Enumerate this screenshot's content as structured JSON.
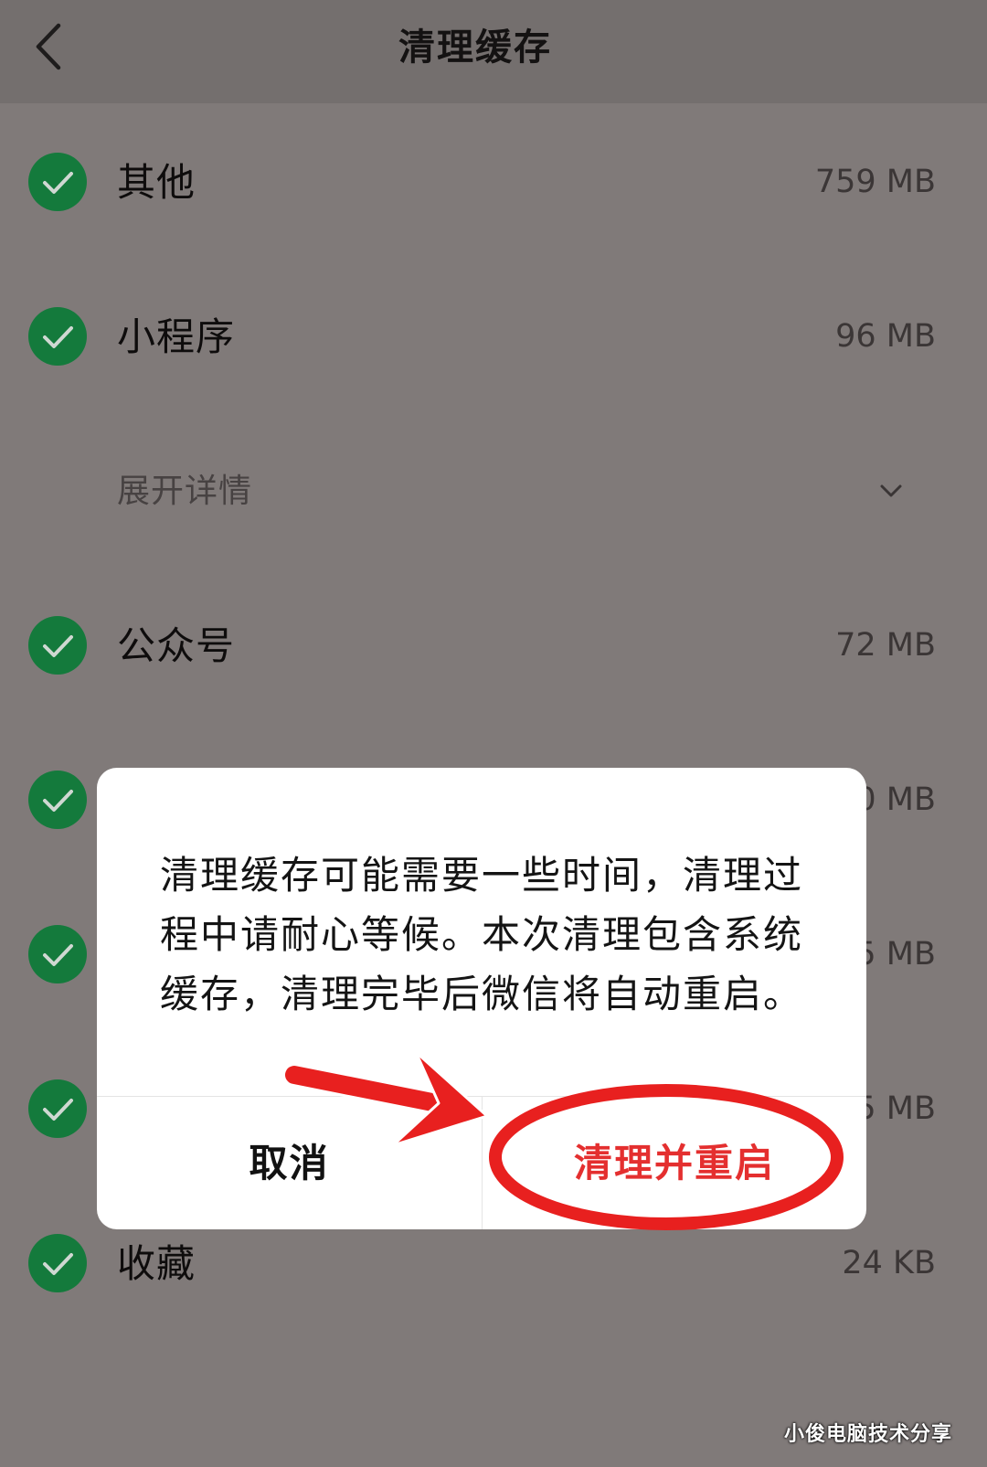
{
  "header": {
    "title": "清理缓存",
    "back_icon": "chevron-left-icon"
  },
  "items": [
    {
      "label": "其他",
      "size": "759 MB",
      "checked": true
    },
    {
      "label": "小程序",
      "size": "96 MB",
      "checked": true
    },
    {
      "label": "公众号",
      "size": "72 MB",
      "checked": true
    },
    {
      "size": "0 MB",
      "checked": true
    },
    {
      "size": "5 MB",
      "checked": true
    },
    {
      "size": "5 MB",
      "checked": true
    },
    {
      "label": "收藏",
      "size": "24 KB",
      "checked": true
    }
  ],
  "expand_details": {
    "label": "展开详情",
    "icon": "chevron-down-icon"
  },
  "dialog": {
    "message_lines": [
      "清理缓存可能需要一些时间，清理过",
      "程中请耐心等候。本次清理包含系统",
      "缓存，清理完毕后微信将自动重启。"
    ],
    "cancel_label": "取消",
    "confirm_label": "清理并重启"
  },
  "icons": {
    "check": "check-circle-icon"
  },
  "colors": {
    "accent_green": "#147a3c",
    "destructive_red": "#e42f2f",
    "annotation_red": "#e8201f"
  },
  "watermark": "小俊电脑技术分享"
}
